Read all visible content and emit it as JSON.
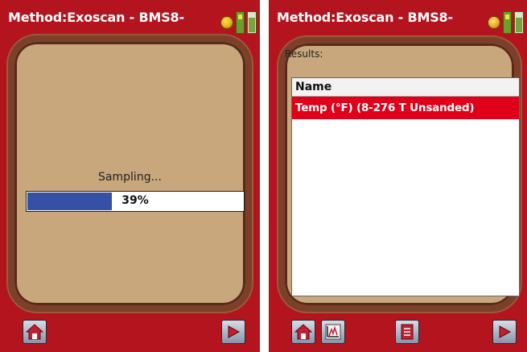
{
  "left_screen": {
    "title": "Method:Exoscan - BMS8-",
    "sampling_label": "Sampling...",
    "progress": {
      "value": 39,
      "label": "39%"
    },
    "buttons": {
      "home": "home-icon",
      "next": "play-icon"
    }
  },
  "right_screen": {
    "title": "Method:Exoscan - BMS8-",
    "results_label": "Results:",
    "list": {
      "header": "Name",
      "rows": [
        "Temp (°F) (8-276 T Unsanded)"
      ]
    },
    "buttons": {
      "home": "home-icon",
      "chart": "chart-icon",
      "document": "document-icon",
      "next": "play-icon"
    }
  },
  "colors": {
    "chrome_red": "#b3141e",
    "panel_tan": "#c9a77c",
    "progress_blue": "#3550a5",
    "selected_row_red": "#e0001a"
  }
}
